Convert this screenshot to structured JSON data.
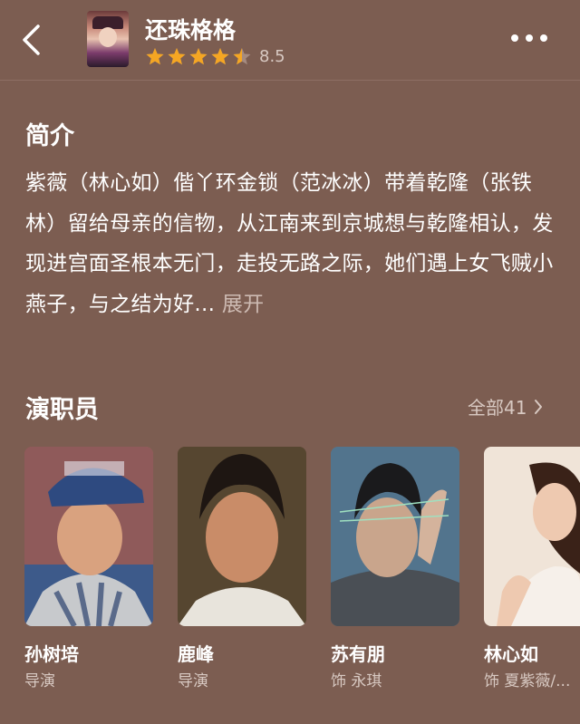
{
  "header": {
    "title": "还珠格格",
    "rating": 8.5,
    "rating_text": "8.5",
    "stars": 4.5,
    "star_color": "#f5a623"
  },
  "intro": {
    "heading": "简介",
    "text": "紫薇（林心如）偕丫环金锁（范冰冰）带着乾隆（张铁林）留给母亲的信物，从江南来到京城想与乾隆相认，发现进宫面圣根本无门，走投无路之际，她们遇上女飞贼小燕子，与之结为好...",
    "expand_label": "展开"
  },
  "cast": {
    "heading": "演职员",
    "all_label": "全部41",
    "members": [
      {
        "name": "孙树培",
        "role": "导演"
      },
      {
        "name": "鹿峰",
        "role": "导演"
      },
      {
        "name": "苏有朋",
        "role": "饰 永琪"
      },
      {
        "name": "林心如",
        "role": "饰 夏紫薇/..."
      }
    ]
  },
  "icons": {
    "back": "back-arrow-icon",
    "more": "more-dots-icon",
    "chevron": "chevron-right-icon",
    "star": "star-icon"
  }
}
